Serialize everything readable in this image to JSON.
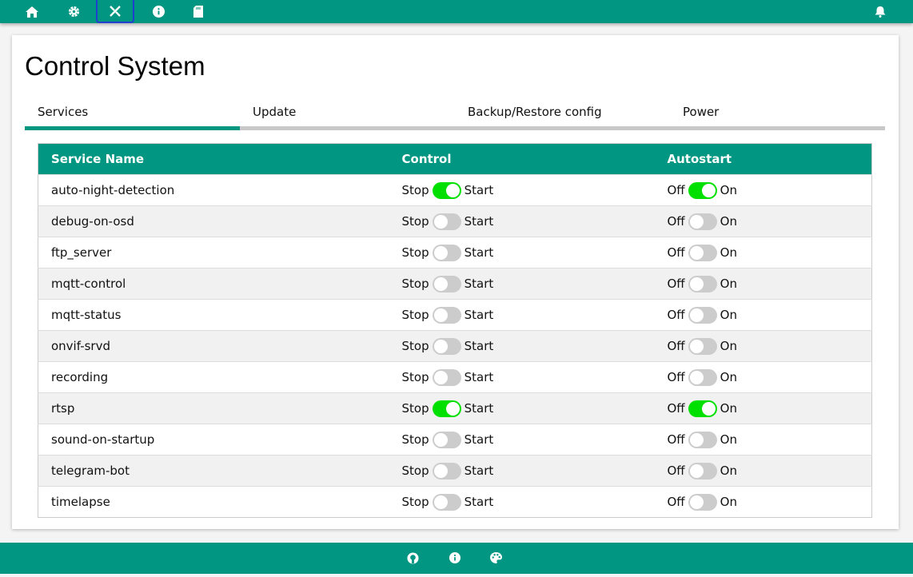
{
  "nav": {
    "icons": [
      "home-icon",
      "gear-icon",
      "tools-icon",
      "info-icon",
      "sd-card-icon"
    ],
    "bell": "bell-icon"
  },
  "page": {
    "title": "Control System"
  },
  "tabs": [
    "Services",
    "Update",
    "Backup/Restore config",
    "Power"
  ],
  "table": {
    "headers": [
      "Service Name",
      "Control",
      "Autostart"
    ],
    "control_labels": {
      "off": "Stop",
      "on": "Start"
    },
    "autostart_labels": {
      "off": "Off",
      "on": "On"
    },
    "rows": [
      {
        "name": "auto-night-detection",
        "running": true,
        "autostart": true
      },
      {
        "name": "debug-on-osd",
        "running": false,
        "autostart": false
      },
      {
        "name": "ftp_server",
        "running": false,
        "autostart": false
      },
      {
        "name": "mqtt-control",
        "running": false,
        "autostart": false
      },
      {
        "name": "mqtt-status",
        "running": false,
        "autostart": false
      },
      {
        "name": "onvif-srvd",
        "running": false,
        "autostart": false
      },
      {
        "name": "recording",
        "running": false,
        "autostart": false
      },
      {
        "name": "rtsp",
        "running": true,
        "autostart": true
      },
      {
        "name": "sound-on-startup",
        "running": false,
        "autostart": false
      },
      {
        "name": "telegram-bot",
        "running": false,
        "autostart": false
      },
      {
        "name": "timelapse",
        "running": false,
        "autostart": false
      }
    ]
  },
  "footer": {
    "icons": [
      "github-icon",
      "info-icon",
      "palette-icon"
    ]
  },
  "colors": {
    "brand": "#009682",
    "toggle_on": "#00e000"
  }
}
